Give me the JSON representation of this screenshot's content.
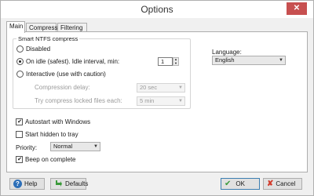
{
  "window": {
    "title": "Options",
    "close_glyph": "✕"
  },
  "tabs": [
    {
      "label": "Main"
    },
    {
      "label": "Compress"
    },
    {
      "label": "Filtering"
    }
  ],
  "ntfs_group": {
    "legend": "Smart NTFS compress",
    "disabled_label": "Disabled",
    "on_idle_label": "On idle (safest). Idle interval, min:",
    "idle_interval_value": "1",
    "interactive_label": "Interactive (use with caution)",
    "compression_delay_label": "Compression delay:",
    "compression_delay_value": "20 sec",
    "try_locked_label": "Try compress locked files each:",
    "try_locked_value": "5 min",
    "selected": "on_idle"
  },
  "language": {
    "label": "Language:",
    "value": "English"
  },
  "options": {
    "autostart_label": "Autostart with Windows",
    "autostart_checked": true,
    "start_hidden_label": "Start hidden to tray",
    "start_hidden_checked": false,
    "priority_label": "Priority:",
    "priority_value": "Normal",
    "beep_label": "Beep on complete",
    "beep_checked": true
  },
  "footer": {
    "help_label": "Help",
    "defaults_label": "Defaults",
    "ok_label": "OK",
    "cancel_label": "Cancel"
  },
  "icons": {
    "help": "help-icon",
    "defaults": "defaults-arrow-icon",
    "ok": "ok-check-icon",
    "cancel": "cancel-x-icon"
  },
  "colors": {
    "accent": "#3c7fb1",
    "close_button": "#c75050",
    "help_icon": "#2d6fb8",
    "defaults_icon": "#3a9a3a",
    "ok_icon": "#3a9a3a",
    "cancel_icon": "#d23a2a"
  }
}
